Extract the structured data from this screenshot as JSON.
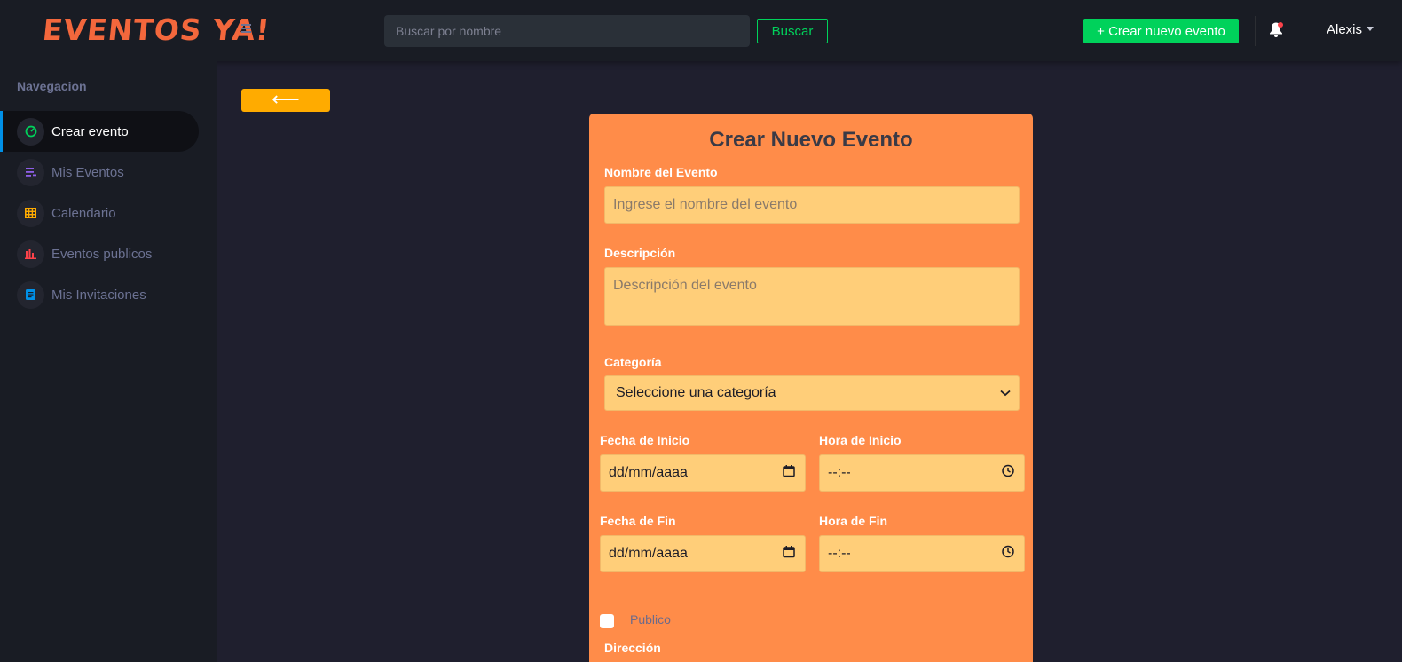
{
  "app": {
    "logo_text": "EVENTOS YA!"
  },
  "navbar": {
    "search_placeholder": "Buscar por nombre",
    "search_button": "Buscar",
    "create_button": "+ Crear nuevo evento",
    "user_name": "Alexis",
    "icons": [
      "menu-icon",
      "bell-icon",
      "caret-down-icon"
    ]
  },
  "sidebar": {
    "heading": "Navegacion",
    "items": [
      {
        "label": "Crear evento",
        "icon": "speedometer-icon",
        "icon_color": "#00d25b",
        "active": true
      },
      {
        "label": "Mis Eventos",
        "icon": "playlist-icon",
        "icon_color": "#8f5fe8",
        "active": false
      },
      {
        "label": "Calendario",
        "icon": "table-grid-icon",
        "icon_color": "#ffab00",
        "active": false
      },
      {
        "label": "Eventos publicos",
        "icon": "bar-chart-icon",
        "icon_color": "#fc424a",
        "active": false
      },
      {
        "label": "Mis Invitaciones",
        "icon": "document-icon",
        "icon_color": "#0090e7",
        "active": false
      }
    ]
  },
  "main": {
    "back_button": "⟵"
  },
  "form": {
    "title": "Crear Nuevo Evento",
    "name_label": "Nombre del Evento",
    "name_placeholder": "Ingrese el nombre del evento",
    "description_label": "Descripción",
    "description_placeholder": "Descripción del evento",
    "category_label": "Categoría",
    "category_selected": "Seleccione una categoría",
    "start_date_label": "Fecha de Inicio",
    "start_date_value": "dd/mm/aaaa",
    "start_time_label": "Hora de Inicio",
    "start_time_value": "--:--",
    "end_date_label": "Fecha de Fin",
    "end_date_value": "dd/mm/aaaa",
    "end_time_label": "Hora de Fin",
    "end_time_value": "--:--",
    "public_label": "Publico",
    "address_label": "Dirección"
  },
  "colors": {
    "accent_green": "#00d25b",
    "card_orange": "#ff8c49",
    "input_yellow": "#ffce79",
    "back_button": "#ffab00",
    "logo": "#f3673c"
  }
}
